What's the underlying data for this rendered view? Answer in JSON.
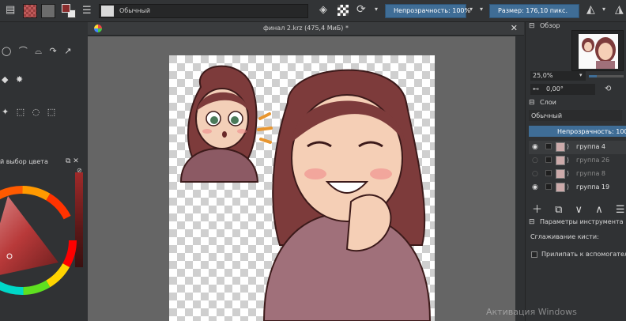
{
  "toolbar": {
    "brush_preset": "Обычный",
    "opacity_label": "Непрозрачность: 100%",
    "size_label": "Размер: 176,10 пикс."
  },
  "left_panel": {
    "color_selector_title": "й выбор цвета"
  },
  "document": {
    "title": "финал 2.krz (475,4 МиБ) *"
  },
  "right_panel": {
    "overview_title": "Обзор",
    "zoom_value": "25,0%",
    "rotation_value": "0,00°",
    "layers_title": "Слои",
    "blend_mode": "Обычный",
    "layer_opacity": "Непрозрачность: 100%",
    "layers": [
      {
        "name": "группа 4",
        "visible": true
      },
      {
        "name": "группа 26",
        "visible": false
      },
      {
        "name": "группа 8",
        "visible": false
      },
      {
        "name": "группа 19",
        "visible": true
      }
    ],
    "tool_options_title": "Параметры инструмента",
    "smoothing_label": "Сглаживание кисти:",
    "snap_label": "Прилипать к вспомогательны"
  },
  "system": {
    "watermark": "Активация Windows"
  },
  "colors": {
    "accent": "#3f6d96",
    "canvas_bg": "#656565",
    "panel_bg": "#303234"
  }
}
